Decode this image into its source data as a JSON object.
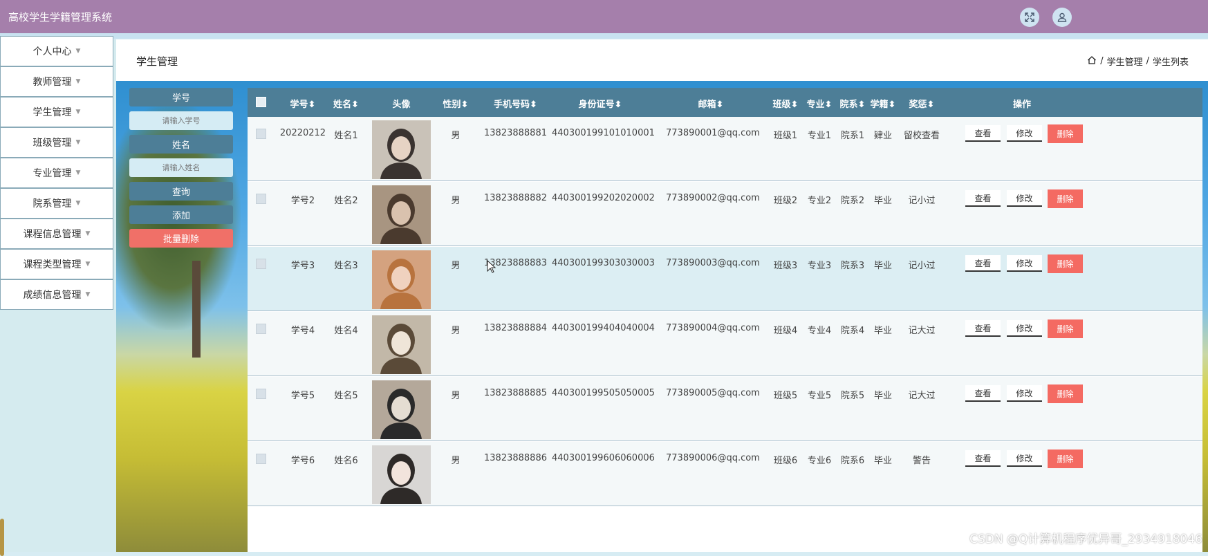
{
  "app": {
    "title": "高校学生学籍管理系统"
  },
  "topbar_icons": [
    "fullscreen-icon",
    "user-icon"
  ],
  "sidebar": {
    "items": [
      {
        "label": "个人中心"
      },
      {
        "label": "教师管理"
      },
      {
        "label": "学生管理"
      },
      {
        "label": "班级管理"
      },
      {
        "label": "专业管理"
      },
      {
        "label": "院系管理"
      },
      {
        "label": "课程信息管理"
      },
      {
        "label": "课程类型管理"
      },
      {
        "label": "成绩信息管理"
      }
    ]
  },
  "header": {
    "title": "学生管理",
    "breadcrumb": [
      "学生管理",
      "学生列表"
    ],
    "breadcrumb_sep": "/"
  },
  "search": {
    "student_no_label": "学号",
    "student_no_placeholder": "请输入学号",
    "name_label": "姓名",
    "name_placeholder": "请输入姓名",
    "query_label": "查询",
    "add_label": "添加",
    "batch_delete_label": "批量删除"
  },
  "table": {
    "columns": [
      "学号",
      "姓名",
      "头像",
      "性别",
      "手机号码",
      "身份证号",
      "邮箱",
      "班级",
      "专业",
      "院系",
      "学籍",
      "奖惩",
      "操作"
    ],
    "sort_glyph": "⬍",
    "actions": {
      "view": "查看",
      "edit": "修改",
      "delete": "删除"
    },
    "rows": [
      {
        "student_no": "20220212",
        "name": "姓名1",
        "gender": "男",
        "phone": "13823888881",
        "id_card": "440300199101010001",
        "email": "773890001@qq.com",
        "class": "班级1",
        "major": "专业1",
        "department": "院系1",
        "status": "肄业",
        "reward": "留校查看"
      },
      {
        "student_no": "学号2",
        "name": "姓名2",
        "gender": "男",
        "phone": "13823888882",
        "id_card": "440300199202020002",
        "email": "773890002@qq.com",
        "class": "班级2",
        "major": "专业2",
        "department": "院系2",
        "status": "毕业",
        "reward": "记小过"
      },
      {
        "student_no": "学号3",
        "name": "姓名3",
        "gender": "男",
        "phone": "13823888883",
        "id_card": "440300199303030003",
        "email": "773890003@qq.com",
        "class": "班级3",
        "major": "专业3",
        "department": "院系3",
        "status": "毕业",
        "reward": "记小过"
      },
      {
        "student_no": "学号4",
        "name": "姓名4",
        "gender": "男",
        "phone": "13823888884",
        "id_card": "440300199404040004",
        "email": "773890004@qq.com",
        "class": "班级4",
        "major": "专业4",
        "department": "院系4",
        "status": "毕业",
        "reward": "记大过"
      },
      {
        "student_no": "学号5",
        "name": "姓名5",
        "gender": "男",
        "phone": "13823888885",
        "id_card": "440300199505050005",
        "email": "773890005@qq.com",
        "class": "班级5",
        "major": "专业5",
        "department": "院系5",
        "status": "毕业",
        "reward": "记大过"
      },
      {
        "student_no": "学号6",
        "name": "姓名6",
        "gender": "男",
        "phone": "13823888886",
        "id_card": "440300199606060006",
        "email": "773890006@qq.com",
        "class": "班级6",
        "major": "专业6",
        "department": "院系6",
        "status": "毕业",
        "reward": "警告"
      }
    ]
  },
  "watermark": "CSDN @Q计算机程序优异哥_2934918046"
}
